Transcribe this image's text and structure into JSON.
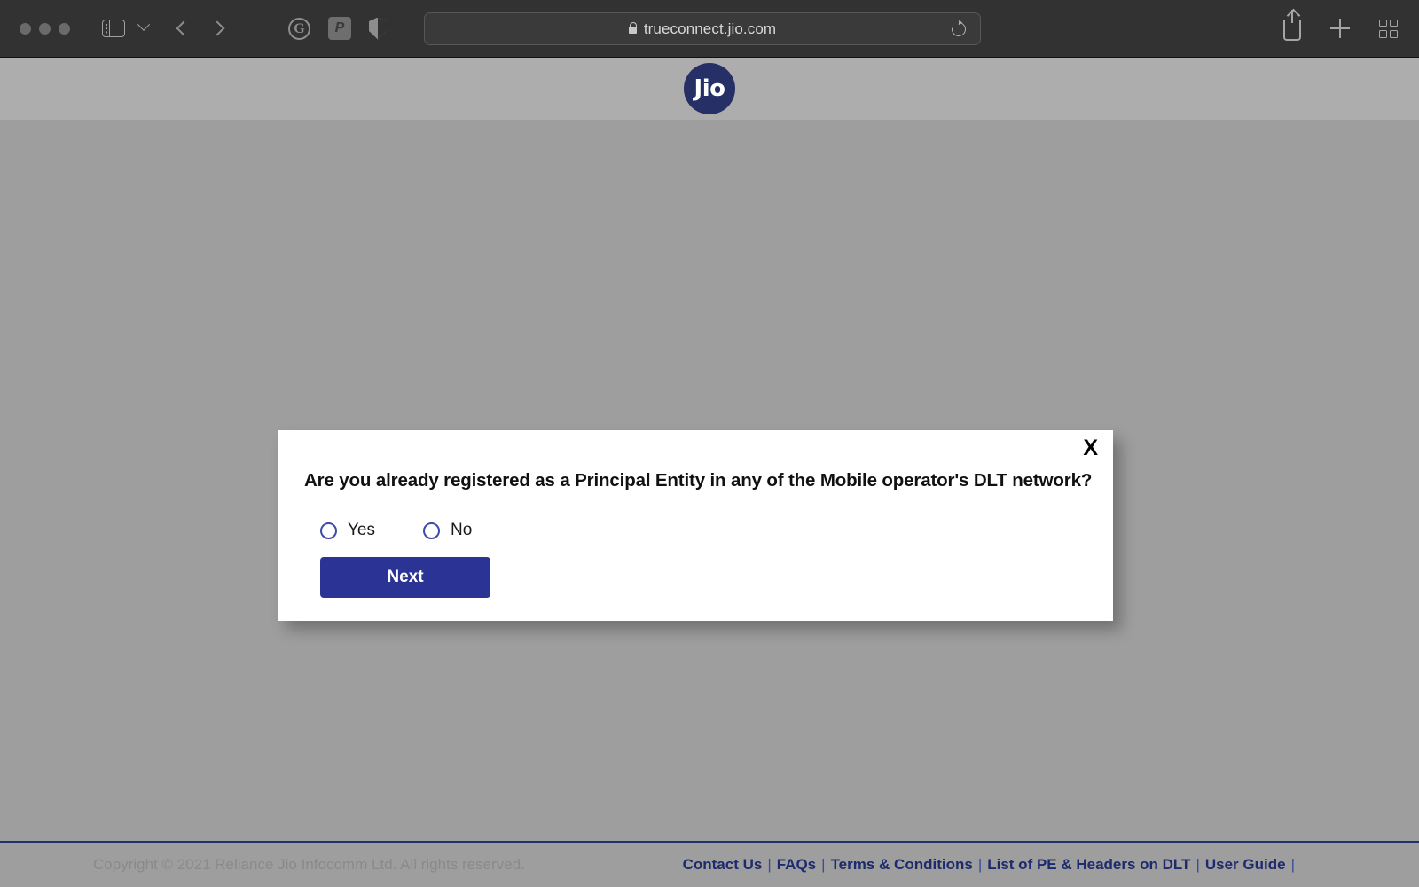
{
  "browser": {
    "url": "trueconnect.jio.com",
    "lock_icon": "padlock-icon",
    "reload_icon": "reload-icon",
    "sidebar_icon": "sidebar-toggle-icon",
    "chevron_icon": "chevron-down-icon",
    "back_icon": "back-arrow-icon",
    "forward_icon": "forward-arrow-icon",
    "extensions": [
      {
        "name": "grammarly-extension-icon",
        "glyph": "G"
      },
      {
        "name": "honey-extension-icon",
        "glyph": "P"
      },
      {
        "name": "privacy-shield-extension-icon",
        "glyph": ""
      }
    ],
    "share_icon": "share-icon",
    "new_tab_icon": "plus-icon",
    "tab_overview_icon": "tab-overview-icon",
    "traffic_lights": [
      "close",
      "minimize",
      "maximize"
    ]
  },
  "header": {
    "logo_text": "Jio",
    "logo_color": "#262f66"
  },
  "modal": {
    "close_label": "X",
    "question": "Are you already registered as a Principal Entity in any of the Mobile operator's DLT network?",
    "options": [
      {
        "label": "Yes",
        "value": "yes",
        "selected": false
      },
      {
        "label": "No",
        "value": "no",
        "selected": false
      }
    ],
    "next_label": "Next",
    "next_color": "#2b3494"
  },
  "footer": {
    "copyright": "Copyright © 2021 Reliance Jio Infocomm Ltd. All rights reserved.",
    "separator": "|",
    "links": [
      {
        "label": "Contact Us"
      },
      {
        "label": "FAQs"
      },
      {
        "label": "Terms & Conditions"
      },
      {
        "label": "List of PE & Headers on DLT"
      },
      {
        "label": "User Guide"
      }
    ],
    "link_color": "#1d2a6e"
  }
}
